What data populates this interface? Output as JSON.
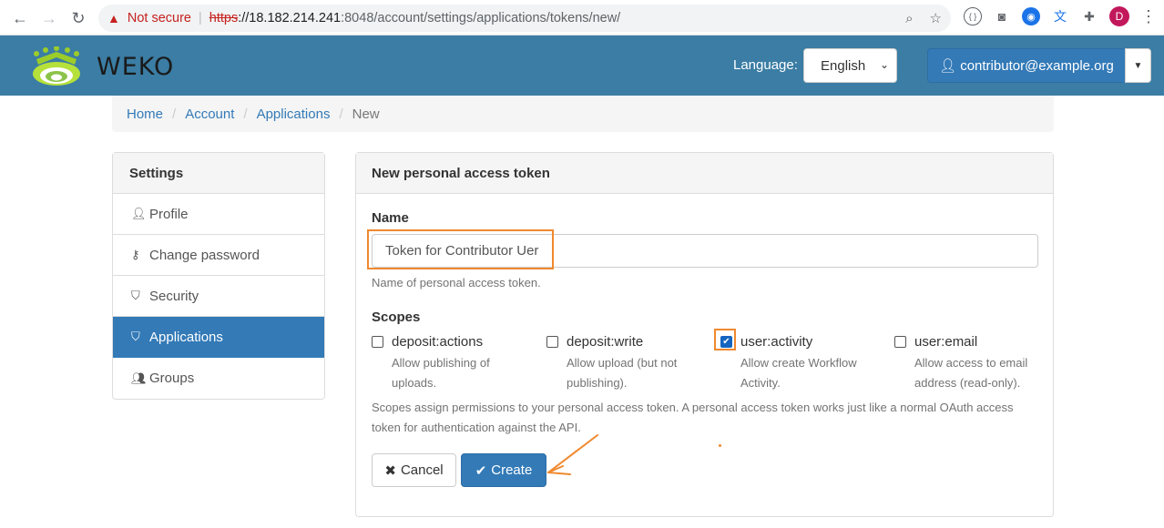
{
  "browser": {
    "security_label": "Not secure",
    "url_scheme": "https",
    "url_host": "://18.182.214.241",
    "url_rest": ":8048/account/settings/applications/tokens/new/",
    "profile_initial": "D"
  },
  "header": {
    "logo_text": "WEKO",
    "language_label": "Language:",
    "language_value": "English",
    "user_label": "contributor@example.org"
  },
  "breadcrumb": {
    "home": "Home",
    "account": "Account",
    "applications": "Applications",
    "current": "New",
    "separator": "/"
  },
  "sidebar": {
    "heading": "Settings",
    "items": [
      {
        "label": "Profile",
        "icon": "user-icon"
      },
      {
        "label": "Change password",
        "icon": "key-icon"
      },
      {
        "label": "Security",
        "icon": "shield-icon"
      },
      {
        "label": "Applications",
        "icon": "shield-icon"
      },
      {
        "label": "Groups",
        "icon": "users-icon"
      }
    ]
  },
  "form": {
    "heading": "New personal access token",
    "name_label": "Name",
    "name_value": "Token for Contributor Uer",
    "name_help": "Name of personal access token.",
    "scopes_label": "Scopes",
    "scopes": [
      {
        "name": "deposit:actions",
        "desc": "Allow publishing of uploads.",
        "checked": false
      },
      {
        "name": "deposit:write",
        "desc": "Allow upload (but not publishing).",
        "checked": false
      },
      {
        "name": "user:activity",
        "desc": "Allow create Workflow Activity.",
        "checked": true
      },
      {
        "name": "user:email",
        "desc": "Allow access to email address (read-only).",
        "checked": false
      }
    ],
    "scopes_help": "Scopes assign permissions to your personal access token. A personal access token works just like a normal OAuth access token for authentication against the API.",
    "cancel_label": "Cancel",
    "create_label": "Create"
  },
  "colors": {
    "header_bg": "#3b7da4",
    "primary": "#337ab7",
    "annotation": "#f0892f"
  }
}
